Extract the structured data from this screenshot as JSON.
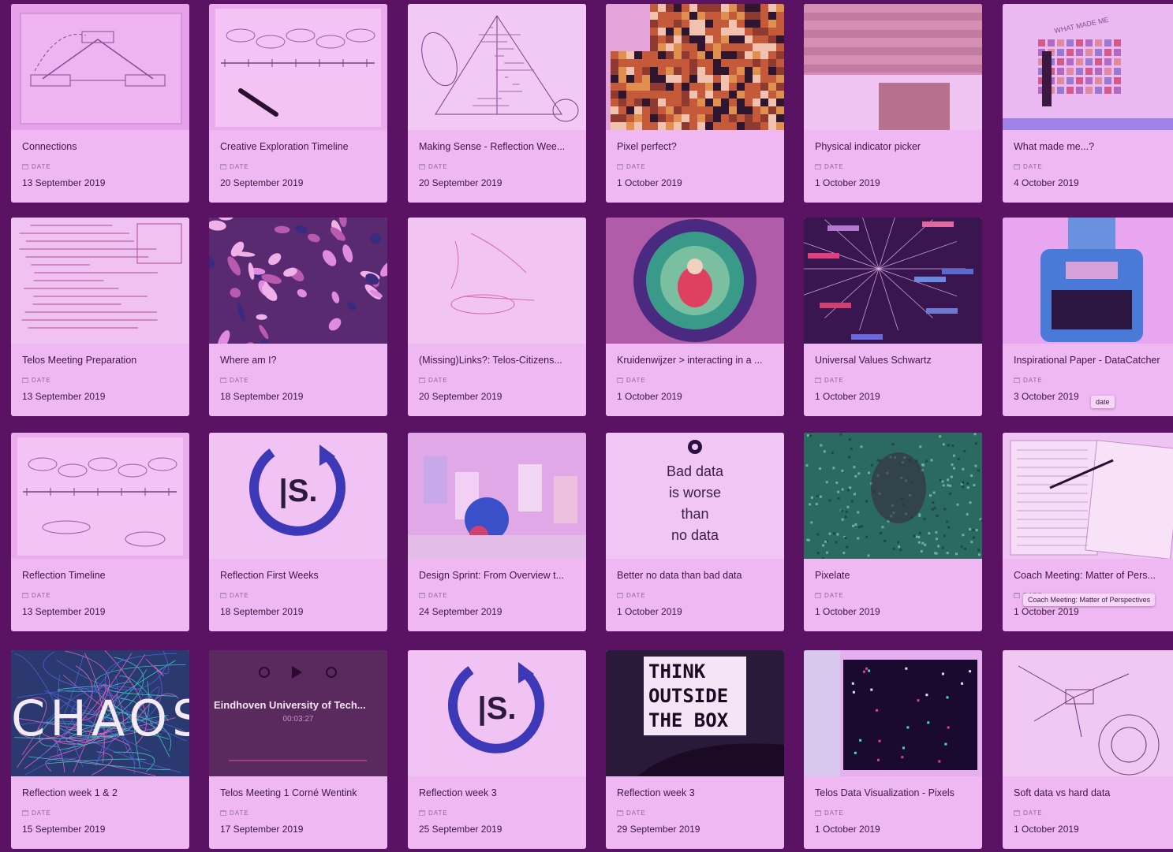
{
  "property_label": "DATE",
  "cards": [
    {
      "title": "Connections",
      "date": "13 September 2019",
      "thumb": "diagram-telos",
      "icon": "sketch-thumbnail"
    },
    {
      "title": "Creative Exploration Timeline",
      "date": "20 September 2019",
      "thumb": "timeline-pen",
      "icon": "sketch-thumbnail"
    },
    {
      "title": "Making Sense - Reflection Wee...",
      "date": "20 September 2019",
      "thumb": "triangle-sketch",
      "icon": "sketch-thumbnail"
    },
    {
      "title": "Pixel perfect?",
      "date": "1 October 2019",
      "thumb": "pixel-tiger",
      "icon": "photo-thumbnail"
    },
    {
      "title": "Physical indicator picker",
      "date": "1 October 2019",
      "thumb": "cardboard",
      "icon": "photo-thumbnail"
    },
    {
      "title": "What made me...?",
      "date": "4 October 2019",
      "thumb": "wall",
      "icon": "photo-thumbnail",
      "thumb_text": "WHAT MADE ME"
    },
    {
      "title": "Telos Meeting Preparation",
      "date": "13 September 2019",
      "thumb": "notes",
      "icon": "sketch-thumbnail"
    },
    {
      "title": "Where am I?",
      "date": "18 September 2019",
      "thumb": "pattern",
      "icon": "photo-thumbnail"
    },
    {
      "title": "(Missing)Links?: Telos-Citizens...",
      "date": "20 September 2019",
      "thumb": "whiteboard",
      "icon": "photo-thumbnail"
    },
    {
      "title": "Kruidenwijzer > interacting in a ...",
      "date": "1 October 2019",
      "thumb": "plate",
      "icon": "photo-thumbnail"
    },
    {
      "title": "Universal Values Schwartz",
      "date": "1 October 2019",
      "thumb": "network",
      "icon": "diagram-thumbnail"
    },
    {
      "title": "Inspirational Paper - DataCatcher",
      "date": "3 October 2019",
      "thumb": "device",
      "icon": "photo-thumbnail",
      "tooltip": "date"
    },
    {
      "title": "Reflection Timeline",
      "date": "13 September 2019",
      "thumb": "timeline-doc",
      "icon": "diagram-thumbnail"
    },
    {
      "title": "Reflection First Weeks",
      "date": "18 September 2019",
      "thumb": "logo-s",
      "icon": "logo-thumbnail",
      "thumb_text": "|S."
    },
    {
      "title": "Design Sprint: From Overview t...",
      "date": "24 September 2019",
      "thumb": "cups",
      "icon": "photo-thumbnail"
    },
    {
      "title": "Better no data than bad data",
      "date": "1 October 2019",
      "thumb": "quote",
      "icon": "quote-thumbnail",
      "thumb_lines": [
        "Bad data",
        "is worse",
        "than",
        "no data"
      ]
    },
    {
      "title": "Pixelate",
      "date": "1 October 2019",
      "thumb": "pixel-face",
      "icon": "photo-thumbnail"
    },
    {
      "title": "Coach Meeting: Matter of Pers...",
      "date": "1 October 2019",
      "thumb": "book",
      "icon": "photo-thumbnail",
      "tooltip": "Coach Meeting: Matter of Perspectives"
    },
    {
      "title": "Reflection week 1 & 2",
      "date": "15 September 2019",
      "thumb": "chaos",
      "icon": "photo-thumbnail",
      "thumb_text": "CHAOS"
    },
    {
      "title": "Telos Meeting 1 Corné Wentink",
      "date": "17 September 2019",
      "thumb": "audio",
      "icon": "audio-thumbnail",
      "thumb_text": "Eindhoven University of Tech...",
      "thumb_sub": "00:03:27"
    },
    {
      "title": "Reflection week 3",
      "date": "25 September 2019",
      "thumb": "logo-s",
      "icon": "logo-thumbnail",
      "thumb_text": "|S."
    },
    {
      "title": "Reflection week 3",
      "date": "29 September 2019",
      "thumb": "lightbox",
      "icon": "photo-thumbnail",
      "thumb_lines": [
        "THINK",
        "OUTSIDE",
        "THE BOX"
      ]
    },
    {
      "title": "Telos Data Visualization - Pixels",
      "date": "1 October 2019",
      "thumb": "screen",
      "icon": "screenshot-thumbnail"
    },
    {
      "title": "Soft data vs hard data",
      "date": "1 October 2019",
      "thumb": "mindmap",
      "icon": "sketch-thumbnail"
    }
  ]
}
